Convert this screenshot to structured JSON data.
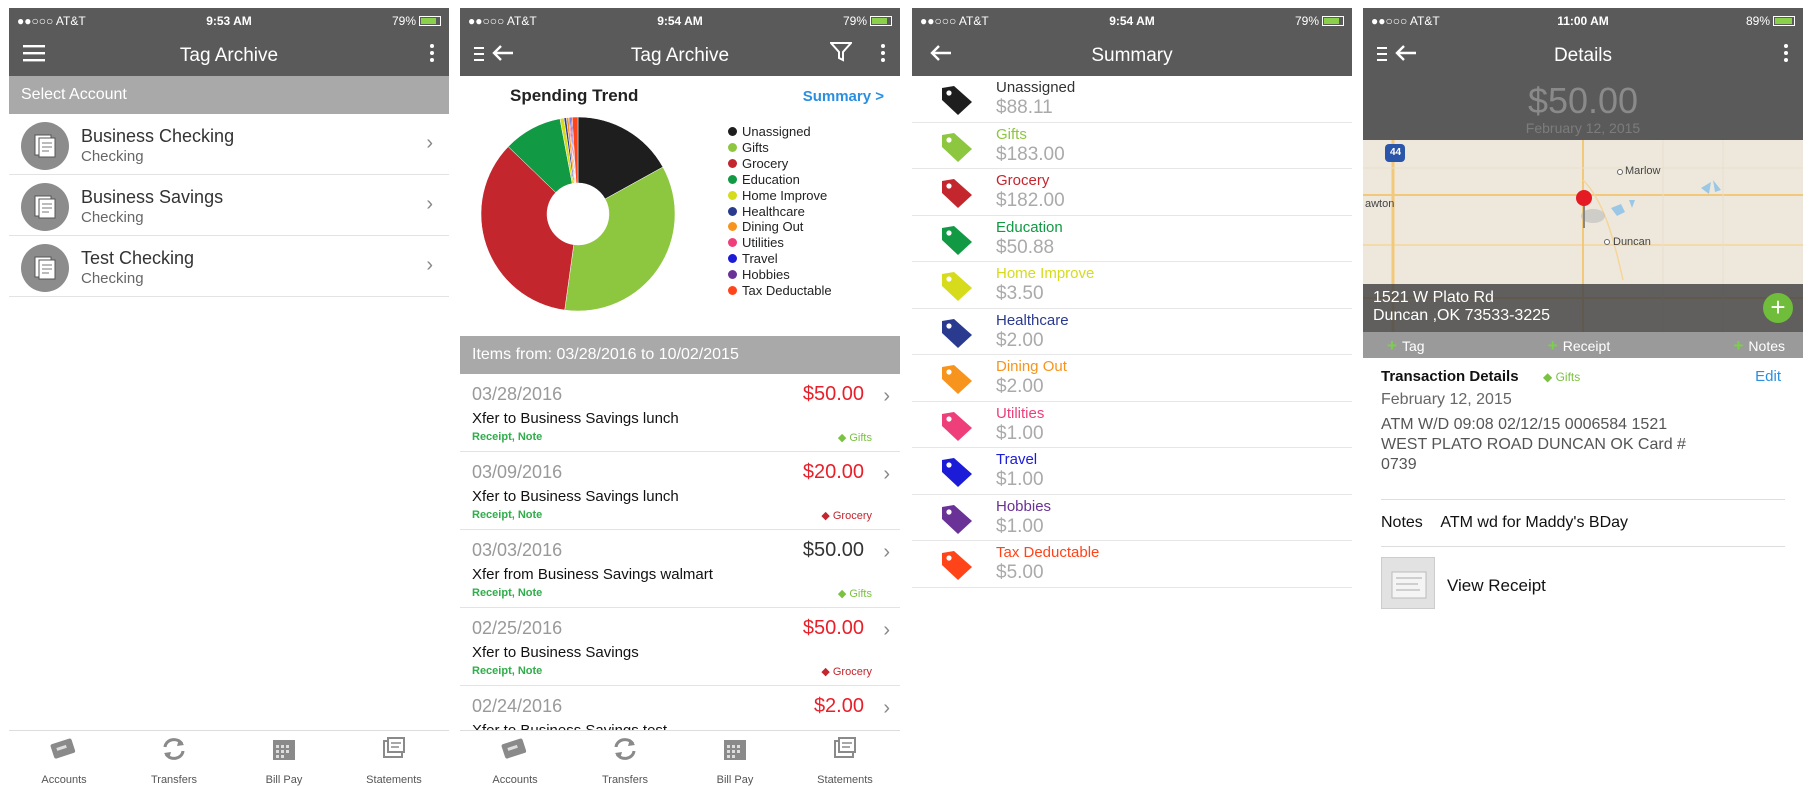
{
  "status": {
    "carrier": "●●○○○ AT&T",
    "time_1": "9:53 AM",
    "time_2": "9:54 AM",
    "time_3": "9:54 AM",
    "time_4": "11:00 AM",
    "battery_1": "79%",
    "battery_4": "89%"
  },
  "screen1": {
    "title": "Tag Archive",
    "section": "Select Account",
    "accounts": [
      {
        "name": "Business Checking",
        "type": "Checking"
      },
      {
        "name": "Business Savings",
        "type": "Checking"
      },
      {
        "name": "Test Checking",
        "type": "Checking"
      }
    ]
  },
  "tabs": [
    "Accounts",
    "Transfers",
    "Bill Pay",
    "Statements"
  ],
  "screen2": {
    "title": "Tag Archive",
    "chart_title": "Spending Trend",
    "summary_link": "Summary >",
    "items_header": "Items from: 03/28/2016 to 10/02/2015",
    "transactions": [
      {
        "date": "03/28/2016",
        "amount": "$50.00",
        "amount_color": "#e8202a",
        "desc": "Xfer to Business Savings lunch",
        "links": "Receipt, Note",
        "tag": "Gifts",
        "tag_color": "#7bc142"
      },
      {
        "date": "03/09/2016",
        "amount": "$20.00",
        "amount_color": "#e8202a",
        "desc": "Xfer to Business Savings lunch",
        "links": "Receipt, Note",
        "tag": "Grocery",
        "tag_color": "#c4262e"
      },
      {
        "date": "03/03/2016",
        "amount": "$50.00",
        "amount_color": "#333333",
        "desc": "Xfer from Business Savings walmart",
        "links": "Receipt, Note",
        "tag": "Gifts",
        "tag_color": "#7bc142"
      },
      {
        "date": "02/25/2016",
        "amount": "$50.00",
        "amount_color": "#e8202a",
        "desc": "Xfer to Business Savings",
        "links": "Receipt, Note",
        "tag": "Grocery",
        "tag_color": "#c4262e"
      },
      {
        "date": "02/24/2016",
        "amount": "$2.00",
        "amount_color": "#e8202a",
        "desc": "Xfer to Business Savings test",
        "links": "",
        "tag": "",
        "tag_color": "#ffffff"
      }
    ]
  },
  "chart_data": {
    "type": "pie",
    "title": "Spending Trend",
    "categories": [
      "Unassigned",
      "Gifts",
      "Grocery",
      "Education",
      "Home Improve",
      "Healthcare",
      "Dining Out",
      "Utilities",
      "Travel",
      "Hobbies",
      "Tax Deductable"
    ],
    "values": [
      88.11,
      183.0,
      182.0,
      50.88,
      3.5,
      2.0,
      2.0,
      1.0,
      1.0,
      1.0,
      5.0
    ],
    "colors": [
      "#1e1e1e",
      "#8dc63f",
      "#c4262e",
      "#119944",
      "#d6db1c",
      "#2a3a8f",
      "#f7941d",
      "#ee3f7a",
      "#1b1bd8",
      "#6a3196",
      "#ff4419"
    ],
    "legend": "right"
  },
  "screen3": {
    "title": "Summary",
    "rows": [
      {
        "name": "Unassigned",
        "amount": "$88.11",
        "color": "#1e1e1e"
      },
      {
        "name": "Gifts",
        "amount": "$183.00",
        "color": "#8dc63f"
      },
      {
        "name": "Grocery",
        "amount": "$182.00",
        "color": "#c4262e"
      },
      {
        "name": "Education",
        "amount": "$50.88",
        "color": "#119944"
      },
      {
        "name": "Home Improve",
        "amount": "$3.50",
        "color": "#d6db1c"
      },
      {
        "name": "Healthcare",
        "amount": "$2.00",
        "color": "#2a3a8f"
      },
      {
        "name": "Dining Out",
        "amount": "$2.00",
        "color": "#f7941d"
      },
      {
        "name": "Utilities",
        "amount": "$1.00",
        "color": "#ee3f7a"
      },
      {
        "name": "Travel",
        "amount": "$1.00",
        "color": "#1b1bd8"
      },
      {
        "name": "Hobbies",
        "amount": "$1.00",
        "color": "#6a3196"
      },
      {
        "name": "Tax Deductable",
        "amount": "$5.00",
        "color": "#ff4419"
      }
    ]
  },
  "screen4": {
    "title": "Details",
    "amount": "$50.00",
    "date": "February 12, 2015",
    "map": {
      "label_marlow": "Marlow",
      "label_duncan": "Duncan",
      "label_lawton": "awton",
      "shield": "44"
    },
    "address_line1": "1521 W Plato Rd",
    "address_line2": "Duncan ,OK 73533-3225",
    "actions": [
      "Tag",
      "Receipt",
      "Notes"
    ],
    "details_title": "Transaction Details",
    "details_tag": "Gifts",
    "edit": "Edit",
    "details_date": "February 12, 2015",
    "memo": "ATM W/D 09:08 02/12/15 0006584 1521 WEST PLATO ROAD DUNCAN OK Card # 0739",
    "notes_label": "Notes",
    "notes_value": "ATM wd for Maddy's BDay",
    "view_receipt": "View Receipt"
  }
}
